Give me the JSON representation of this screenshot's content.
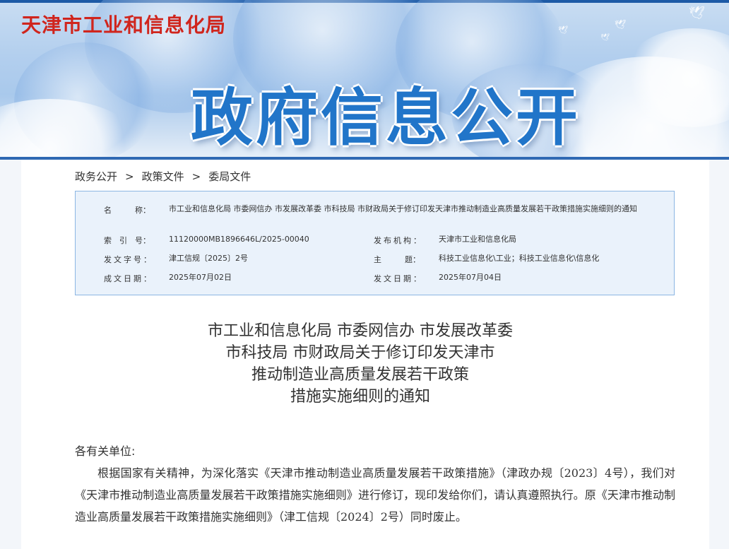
{
  "header": {
    "site_name": "天津市工业和信息化局",
    "banner_title": "政府信息公开"
  },
  "breadcrumb": {
    "items": [
      "政务公开",
      "政策文件",
      "委局文件"
    ],
    "separator": ">"
  },
  "info": {
    "name_label": "名　　　称：",
    "name_value": "市工业和信息化局 市委网信办 市发展改革委 市科技局 市财政局关于修订印发天津市推动制造业高质量发展若干政策措施实施细则的通知",
    "index_label": "索　引　号：",
    "index_value": "11120000MB1896646L/2025-00040",
    "publisher_label": "发布机构：",
    "publisher_value": "天津市工业和信息化局",
    "doc_no_label": "发文字号：",
    "doc_no_value": "津工信规〔2025〕2号",
    "subject_label": "主　　　题：",
    "subject_value": "科技工业信息化\\工业；科技工业信息化\\信息化",
    "created_label": "成文日期：",
    "created_value": "2025年07月02日",
    "issued_label": "发文日期：",
    "issued_value": "2025年07月04日"
  },
  "document": {
    "title_lines": [
      "市工业和信息化局  市委网信办  市发展改革委",
      "市科技局  市财政局关于修订印发天津市",
      "推动制造业高质量发展若干政策",
      "措施实施细则的通知"
    ],
    "salutation": "各有关单位:",
    "paragraph": "根据国家有关精神，为深化落实《天津市推动制造业高质量发展若干政策措施》（津政办规〔2023〕4号），我们对《天津市推动制造业高质量发展若干政策措施实施细则》进行修订，现印发给你们，请认真遵照执行。原《天津市推动制造业高质量发展若干政策措施实施细则》（津工信规〔2024〕2号）同时废止。"
  },
  "colors": {
    "site_name": "#d0251d",
    "banner_title": "#2175c9",
    "info_box_bg": "#eaf2fb",
    "info_box_border": "#8cb6e3"
  }
}
